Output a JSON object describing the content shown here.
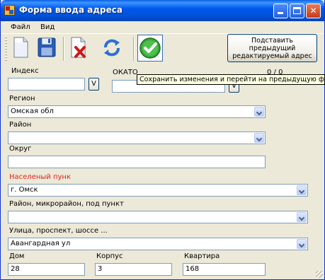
{
  "window": {
    "title": "Форма ввода адреса"
  },
  "menu": {
    "items": [
      "Файл",
      "Вид"
    ]
  },
  "toolbar": {
    "buttons": [
      {
        "name": "new-document",
        "icon": "document-icon"
      },
      {
        "name": "save",
        "icon": "floppy-disk-icon"
      },
      {
        "name": "delete",
        "icon": "delete-document-icon"
      },
      {
        "name": "refresh",
        "icon": "refresh-icon"
      },
      {
        "name": "save-and-go-previous",
        "icon": "green-checkmark-icon"
      }
    ],
    "prev_address_button": [
      "Подставить",
      "предыдущий",
      "редактируемый адрес"
    ],
    "tooltip": "Сохранить изменения и перейти на предыдущую форму"
  },
  "form": {
    "index": {
      "label": "Индекс",
      "value": "",
      "button": "V"
    },
    "okato": {
      "label": "ОКАТО",
      "value": "",
      "button": "V"
    },
    "counter": "0 / 0",
    "region": {
      "label": "Регион",
      "value": "Омская обл"
    },
    "district": {
      "label": "Район",
      "value": ""
    },
    "okrug": {
      "label": "Округ",
      "value": ""
    },
    "locality": {
      "label": "Населеный пунк",
      "value": "г. Омск"
    },
    "microdistrict": {
      "label": "Район, микрорайон, под пункт",
      "value": ""
    },
    "street": {
      "label": "Улица, проспект, шоссе ...",
      "value": "Авангардная ул"
    },
    "house": {
      "label": "Дом",
      "value": "28"
    },
    "building": {
      "label": "Корпус",
      "value": "3"
    },
    "apartment": {
      "label": "Квартира",
      "value": "168"
    }
  },
  "colors": {
    "titlebar": "#0058ee",
    "required_label": "#e2211c",
    "window_bg": "#ece9d8"
  }
}
